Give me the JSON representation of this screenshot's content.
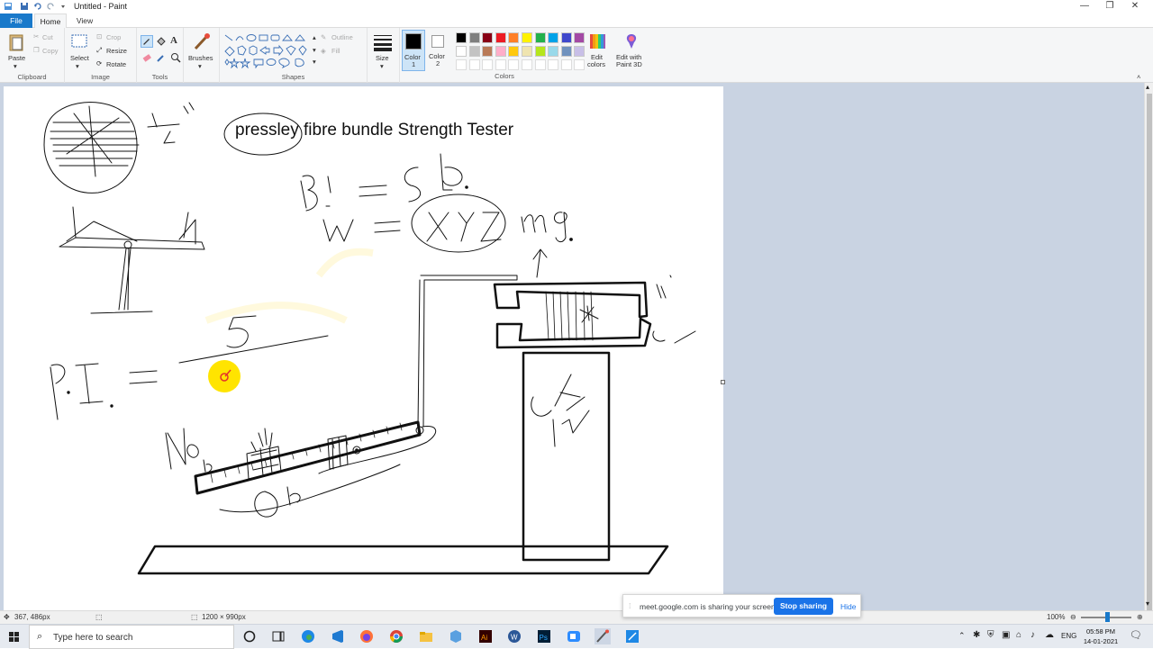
{
  "window": {
    "title": "Untitled - Paint",
    "minimize_icon": "minimize-icon",
    "restore_icon": "restore-icon",
    "close_icon": "close-icon"
  },
  "tabs": {
    "file": "File",
    "home": "Home",
    "view": "View"
  },
  "ribbon": {
    "clipboard": {
      "paste": "Paste",
      "cut": "Cut",
      "copy": "Copy",
      "group": "Clipboard"
    },
    "image": {
      "select": "Select",
      "crop": "Crop",
      "resize": "Resize",
      "rotate": "Rotate",
      "group": "Image"
    },
    "tools": {
      "group": "Tools"
    },
    "brushes": {
      "label": "Brushes"
    },
    "shapes": {
      "outline": "Outline",
      "fill": "Fill",
      "group": "Shapes"
    },
    "size": {
      "label": "Size"
    },
    "color1": {
      "label1": "Color",
      "label2": "1",
      "value": "#000000"
    },
    "color2": {
      "label1": "Color",
      "label2": "2",
      "value": "#ffffff"
    },
    "colors": {
      "group": "Colors",
      "palette_row1": [
        "#000000",
        "#7f7f7f",
        "#880015",
        "#ed1c24",
        "#ff7f27",
        "#fff200",
        "#22b14c",
        "#00a2e8",
        "#3f48cc",
        "#a349a4"
      ],
      "palette_row2": [
        "#ffffff",
        "#c3c3c3",
        "#b97a57",
        "#ffaec9",
        "#ffc90e",
        "#efe4b0",
        "#b5e61d",
        "#99d9ea",
        "#7092be",
        "#c8bfe7"
      ]
    },
    "edit_colors": {
      "label1": "Edit",
      "label2": "colors"
    },
    "edit_3d": {
      "label1": "Edit with",
      "label2": "Paint 3D"
    }
  },
  "canvas": {
    "heading": "pressley fibre bundle Strength Tester"
  },
  "status": {
    "cursor_pos": "367, 486px",
    "canvas_size": "1200 × 990px",
    "zoom": "100%"
  },
  "share_banner": {
    "text": "meet.google.com is sharing your screen.",
    "stop": "Stop sharing",
    "hide": "Hide"
  },
  "taskbar": {
    "search_placeholder": "Type here to search",
    "lang": "ENG",
    "time": "05:58 PM",
    "date": "14-01-2021"
  }
}
